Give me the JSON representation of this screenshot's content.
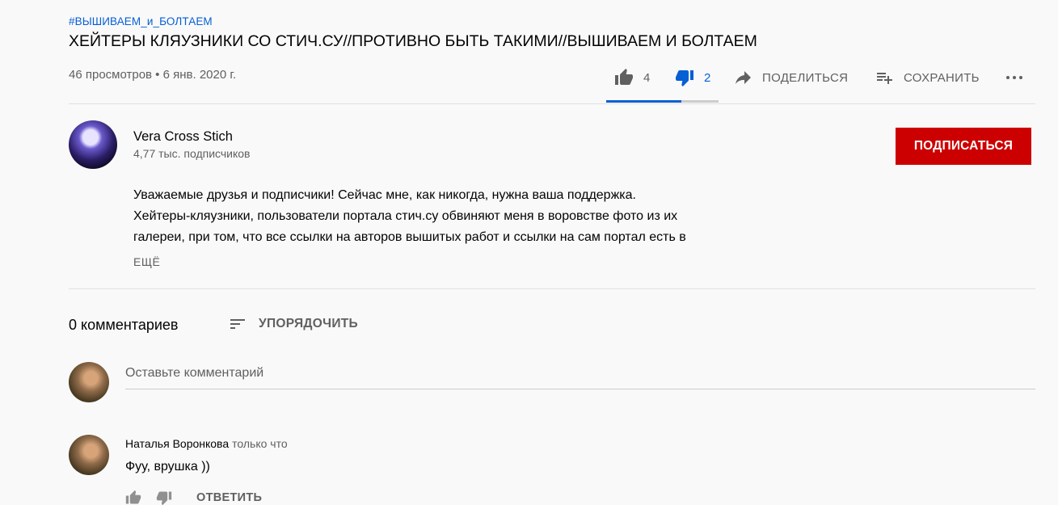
{
  "video": {
    "hashtag": "#ВЫШИВАЕМ_и_БОЛТАЕМ",
    "title": "ХЕЙТЕРЫ КЛЯУЗНИКИ СО СТИЧ.СУ//ПРОТИВНО БЫТЬ ТАКИМИ//ВЫШИВАЕМ И БОЛТАЕМ",
    "meta": "46 просмотров • 6 янв. 2020 г."
  },
  "actions": {
    "likes": "4",
    "dislikes": "2",
    "share_label": "ПОДЕЛИТЬСЯ",
    "save_label": "СОХРАНИТЬ",
    "like_ratio": 0.67
  },
  "channel": {
    "name": "Vera Cross Stich",
    "subscribers": "4,77 тыс. подписчиков",
    "subscribe_label": "ПОДПИСАТЬСЯ"
  },
  "description": {
    "lines": [
      "Уважаемые друзья и подписчики! Сейчас мне, как никогда, нужна ваша поддержка.",
      "Хейтеры-кляузники, пользователи портала стич.су обвиняют меня в воровстве фото из их",
      "галереи, при том, что все ссылки на авторов вышитых работ и ссылки на сам портал есть в"
    ],
    "more_label": "ЕЩЁ"
  },
  "comments": {
    "count_label": "0 комментариев",
    "sort_label": "УПОРЯДОЧИТЬ",
    "input_placeholder": "Оставьте комментарий",
    "items": [
      {
        "author": "Наталья Воронкова",
        "time": "только что",
        "text": "Фуу, врушка ))",
        "reply_label": "ОТВЕТИТЬ"
      }
    ]
  },
  "colors": {
    "accent": "#065fd4",
    "subscribe": "#cc0000",
    "secondary_text": "#606060"
  },
  "icons": [
    "thumb-up-icon",
    "thumb-down-icon",
    "share-icon",
    "playlist-add-icon",
    "more-icon",
    "sort-icon"
  ]
}
